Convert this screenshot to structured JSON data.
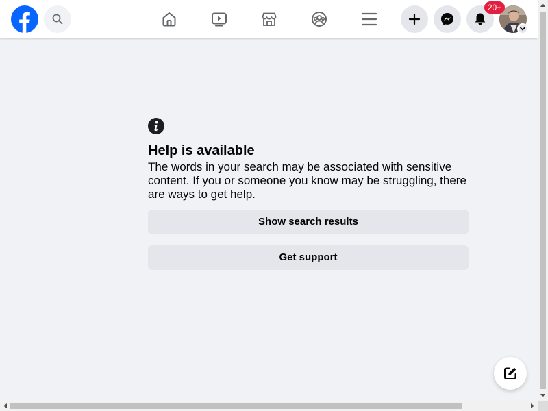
{
  "topbar": {
    "logo_icon": "facebook-logo",
    "search_icon": "search-icon",
    "nav": [
      {
        "icon": "home-icon"
      },
      {
        "icon": "watch-icon"
      },
      {
        "icon": "marketplace-icon"
      },
      {
        "icon": "groups-icon"
      },
      {
        "icon": "menu-icon"
      }
    ],
    "actions": [
      {
        "icon": "plus-icon"
      },
      {
        "icon": "messenger-icon"
      },
      {
        "icon": "bell-icon"
      }
    ],
    "notification_badge": "20+",
    "account_icon": "avatar"
  },
  "main": {
    "info_icon": "info-icon",
    "heading": "Help is available",
    "body": "The words in your search may be associated with sensitive content. If you or someone you know may be struggling, there are ways to get help.",
    "show_results_label": "Show search results",
    "get_support_label": "Get support"
  },
  "compose_icon": "compose-icon",
  "colors": {
    "brand": "#0866ff",
    "background": "#f0f2f5",
    "button": "#e4e6eb",
    "badge": "#e41e3f",
    "text": "#050505",
    "icon": "#65676b"
  }
}
